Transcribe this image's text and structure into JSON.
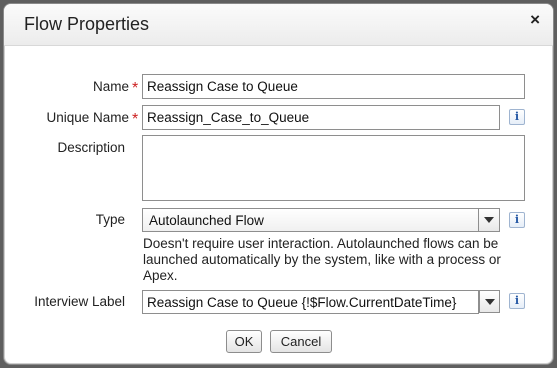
{
  "dialog": {
    "title": "Flow Properties",
    "close_glyph": "×",
    "close_icon": "close-icon"
  },
  "form": {
    "name": {
      "label": "Name",
      "required_mark": "*",
      "value": "Reassign Case to Queue"
    },
    "unique_name": {
      "label": "Unique Name",
      "required_mark": "*",
      "value": "Reassign_Case_to_Queue",
      "info_glyph": "i"
    },
    "description": {
      "label": "Description",
      "value": ""
    },
    "type": {
      "label": "Type",
      "selected": "Autolaunched Flow",
      "info_glyph": "i",
      "help_text": "Doesn't require user interaction. Autolaunched flows can be launched automatically by the system, like with a process or Apex."
    },
    "interview_label": {
      "label": "Interview Label",
      "value": "Reassign Case to Queue {!$Flow.CurrentDateTime}",
      "info_glyph": "i"
    }
  },
  "buttons": {
    "ok": "OK",
    "cancel": "Cancel"
  },
  "colors": {
    "required": "#cc2222",
    "info_icon": "#2659a5"
  }
}
